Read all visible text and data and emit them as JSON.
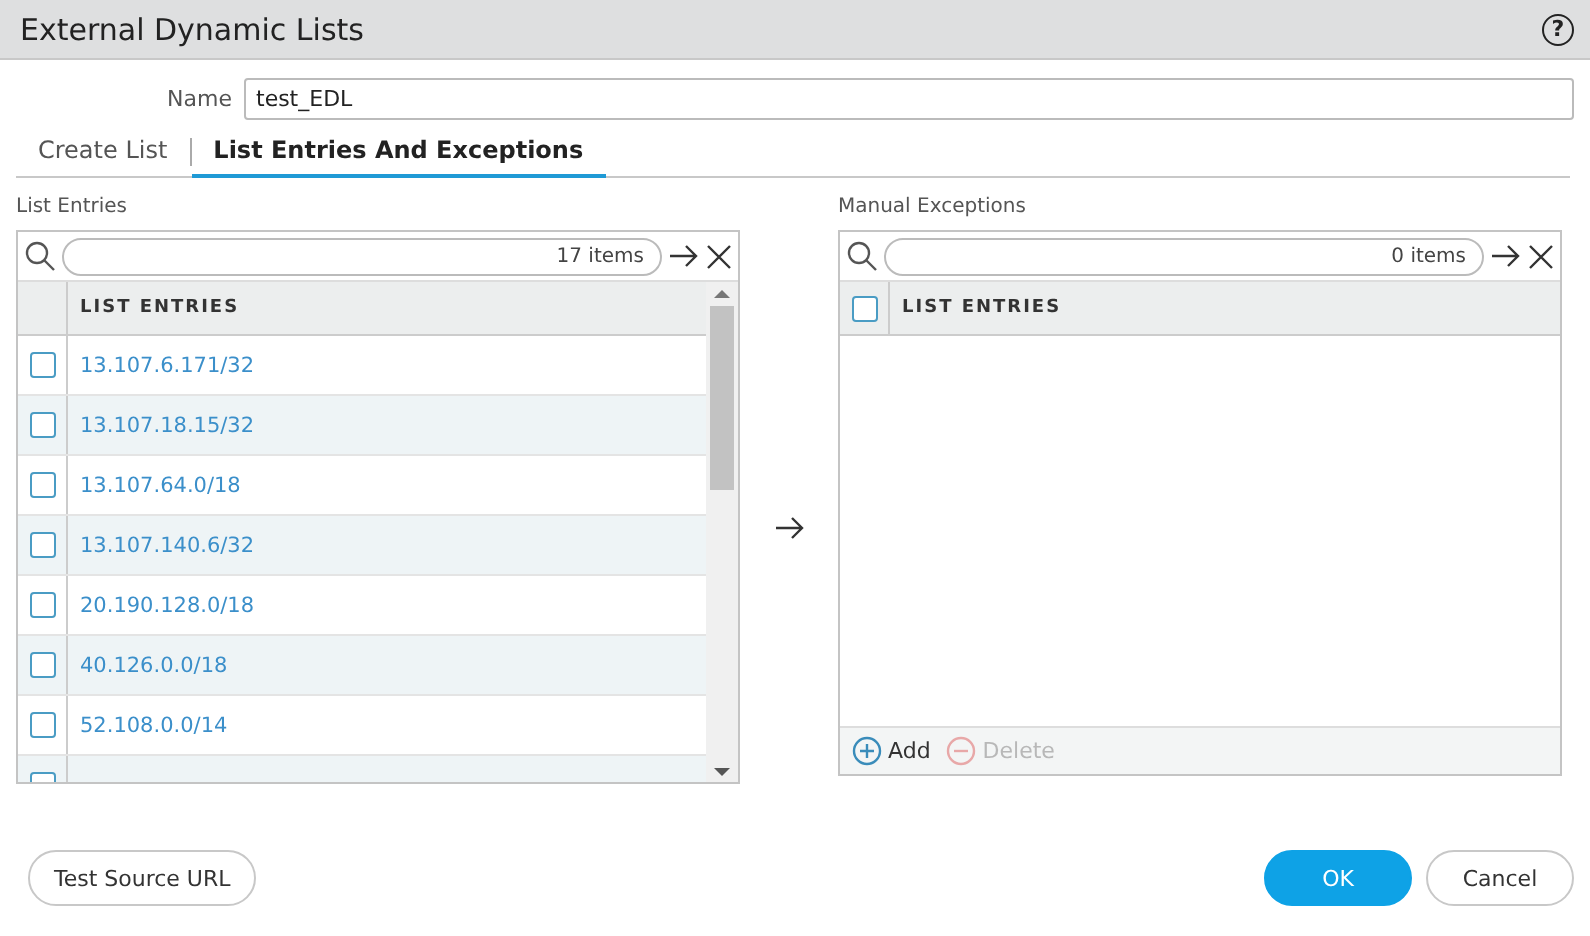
{
  "window": {
    "title": "External Dynamic Lists",
    "help": "?"
  },
  "name_field": {
    "label": "Name",
    "value": "test_EDL"
  },
  "tabs": [
    {
      "label": "Create List",
      "selected": false
    },
    {
      "label": "List Entries And Exceptions",
      "selected": true
    }
  ],
  "list_entries": {
    "title": "List Entries",
    "count": "17 items",
    "column": "LIST ENTRIES",
    "rows": [
      {
        "value": "13.107.6.171/32",
        "checked": false
      },
      {
        "value": "13.107.18.15/32",
        "checked": false
      },
      {
        "value": "13.107.64.0/18",
        "checked": false
      },
      {
        "value": "13.107.140.6/32",
        "checked": false
      },
      {
        "value": "20.190.128.0/18",
        "checked": false
      },
      {
        "value": "40.126.0.0/18",
        "checked": false
      },
      {
        "value": "52.108.0.0/14",
        "checked": false
      }
    ],
    "partial_row_checked": false
  },
  "manual_exceptions": {
    "title": "Manual Exceptions",
    "count": "0 items",
    "column": "LIST ENTRIES",
    "header_checked": false,
    "actions": [
      {
        "label": "Add",
        "disabled": false
      },
      {
        "label": "Delete",
        "disabled": true
      }
    ]
  },
  "buttons": [
    {
      "label": "Test Source URL",
      "kind": "secondary"
    },
    {
      "label": "OK",
      "kind": "primary"
    },
    {
      "label": "Cancel",
      "kind": "secondary"
    }
  ]
}
